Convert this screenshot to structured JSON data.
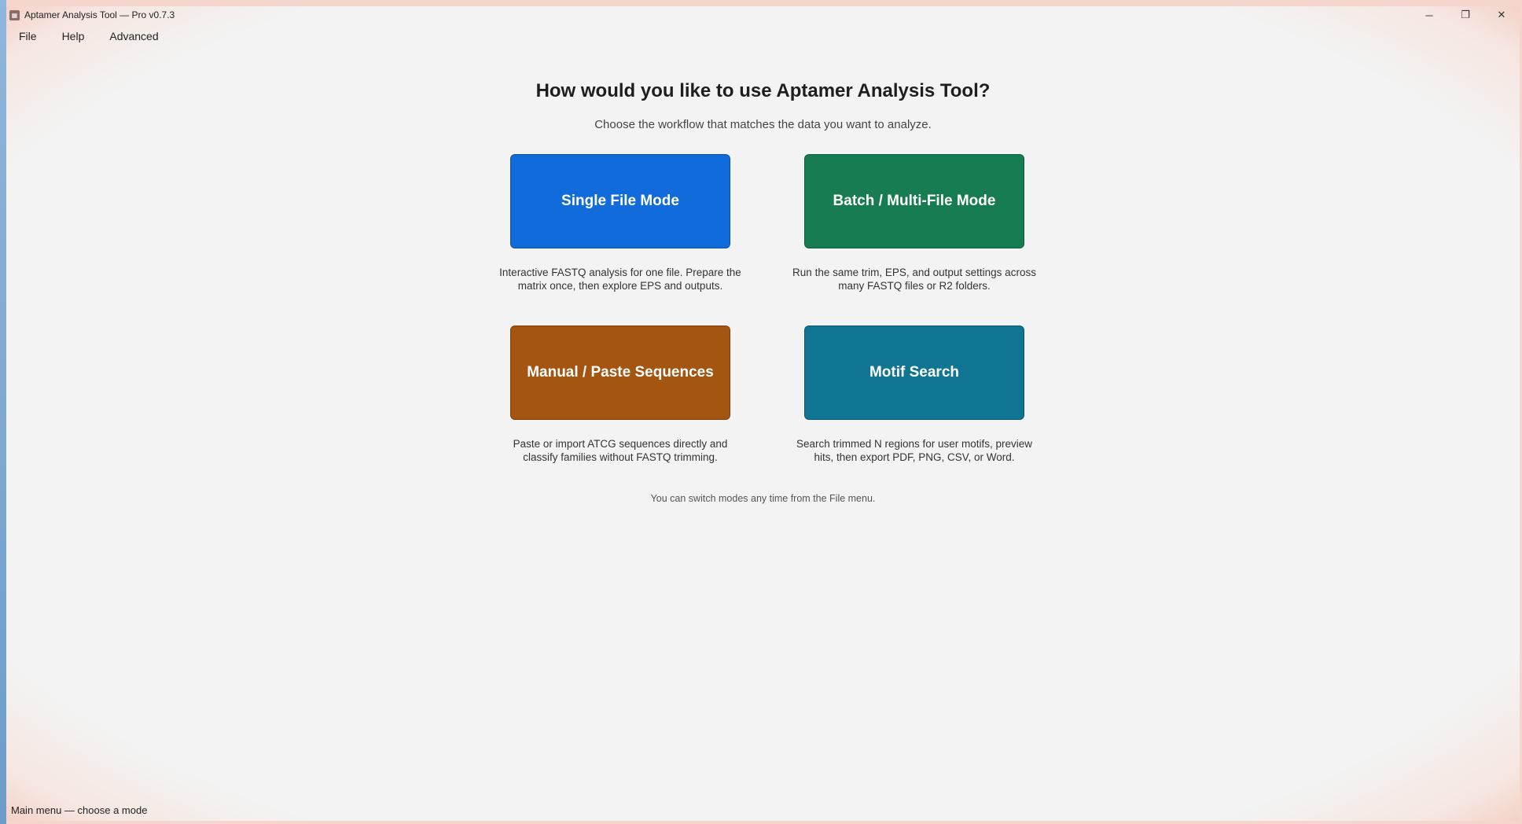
{
  "window": {
    "title": "Aptamer Analysis Tool — Pro v0.7.3",
    "controls": {
      "minimize": "─",
      "restore": "❐",
      "close": "✕"
    }
  },
  "menu": {
    "items": [
      "File",
      "Help",
      "Advanced"
    ]
  },
  "main": {
    "heading": "How would you like to use Aptamer Analysis Tool?",
    "subheading": "Choose the workflow that matches the data you want to analyze.",
    "modes": [
      {
        "label": "Single File Mode",
        "color": "#116bdb",
        "description_line1": "Interactive FASTQ analysis for one file. Prepare the",
        "description_line2": "matrix once, then explore EPS and outputs."
      },
      {
        "label": "Batch / Multi-File Mode",
        "color": "#177c4f",
        "description_line1": "Run the same trim, EPS, and output settings across",
        "description_line2": "many FASTQ files or R2 folders."
      },
      {
        "label": "Manual / Paste Sequences",
        "color": "#a35511",
        "description_line1": "Paste or import ATCG sequences directly and",
        "description_line2": "classify families without FASTQ trimming."
      },
      {
        "label": "Motif Search",
        "color": "#107592",
        "description_line1": "Search trimmed N regions for user motifs, preview",
        "description_line2": "hits, then export PDF, PNG, CSV, or Word."
      }
    ],
    "hint": "You can switch modes any time from the File menu."
  },
  "status": {
    "text": "Main menu — choose a mode"
  }
}
